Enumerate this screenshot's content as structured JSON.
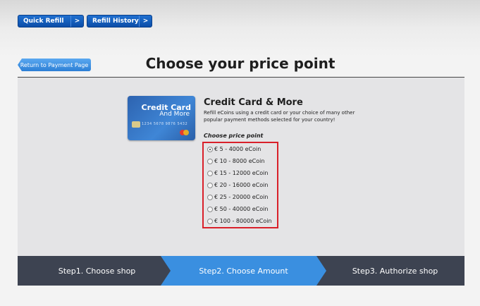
{
  "topnav": {
    "quick_refill": "Quick Refill",
    "refill_history": "Refill History",
    "chevron": ">"
  },
  "return_label": "Return to Payment Page",
  "page_title": "Choose your price point",
  "card": {
    "line1": "Credit Card",
    "line2": "And More",
    "number": "1234 5678 9876 5432"
  },
  "payment": {
    "title": "Credit Card & More",
    "description": "Refill eCoins using a credit card or your choice of many other popular payment methods selected for your country!",
    "choose_label": "Choose price point"
  },
  "options": [
    {
      "label": "€ 5 - 4000 eCoin",
      "selected": true
    },
    {
      "label": "€ 10 - 8000 eCoin",
      "selected": false
    },
    {
      "label": "€ 15 - 12000 eCoin",
      "selected": false
    },
    {
      "label": "€ 20 - 16000 eCoin",
      "selected": false
    },
    {
      "label": "€ 25 - 20000 eCoin",
      "selected": false
    },
    {
      "label": "€ 50 - 40000 eCoin",
      "selected": false
    },
    {
      "label": "€ 100 - 80000 eCoin",
      "selected": false
    }
  ],
  "steps": [
    {
      "label": "Step1. Choose shop",
      "active": false
    },
    {
      "label": "Step2. Choose Amount",
      "active": true
    },
    {
      "label": "Step3. Authorize shop",
      "active": false
    }
  ],
  "colors": {
    "nav_blue": "#0c4ea8",
    "active_step": "#3a8fe0",
    "inactive_step": "#3d4351",
    "highlight_border": "#d9202a"
  }
}
